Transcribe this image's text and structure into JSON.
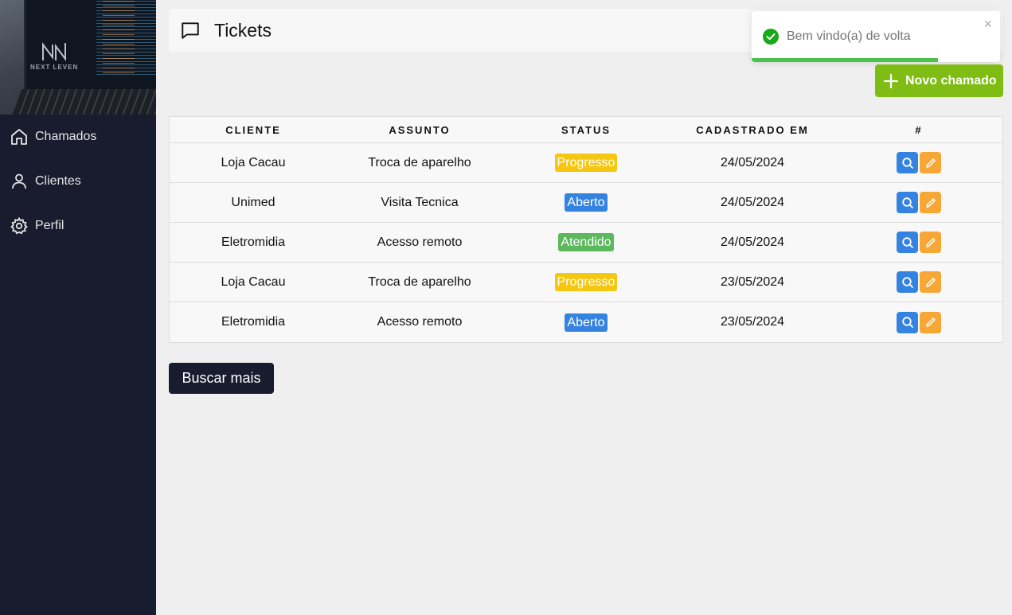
{
  "sidebar": {
    "logo_text": "NEXT LEVEN",
    "items": [
      {
        "label": "Chamados",
        "icon": "home-icon"
      },
      {
        "label": "Clientes",
        "icon": "user-icon"
      },
      {
        "label": "Perfil",
        "icon": "gear-icon"
      }
    ]
  },
  "header": {
    "title": "Tickets",
    "icon": "message-square-icon"
  },
  "toast": {
    "message": "Bem vindo(a) de volta",
    "close": "×",
    "progress": 0.75,
    "color": "#4cc24c"
  },
  "new_button": {
    "label": "Novo chamado",
    "color": "#7fbd14"
  },
  "table": {
    "columns": [
      "CLIENTE",
      "ASSUNTO",
      "STATUS",
      "CADASTRADO EM",
      "#"
    ],
    "rows": [
      {
        "cliente": "Loja Cacau",
        "assunto": "Troca de aparelho",
        "status": "Progresso",
        "data": "24/05/2024"
      },
      {
        "cliente": "Unimed",
        "assunto": "Visita Tecnica",
        "status": "Aberto",
        "data": "24/05/2024"
      },
      {
        "cliente": "Eletromidia",
        "assunto": "Acesso remoto",
        "status": "Atendido",
        "data": "24/05/2024"
      },
      {
        "cliente": "Loja Cacau",
        "assunto": "Troca de aparelho",
        "status": "Progresso",
        "data": "23/05/2024"
      },
      {
        "cliente": "Eletromidia",
        "assunto": "Acesso remoto",
        "status": "Aberto",
        "data": "23/05/2024"
      }
    ]
  },
  "status_colors": {
    "Progresso": "#f5c710",
    "Aberto": "#3583e0",
    "Atendido": "#5cb85c"
  },
  "more_button": {
    "label": "Buscar mais"
  }
}
